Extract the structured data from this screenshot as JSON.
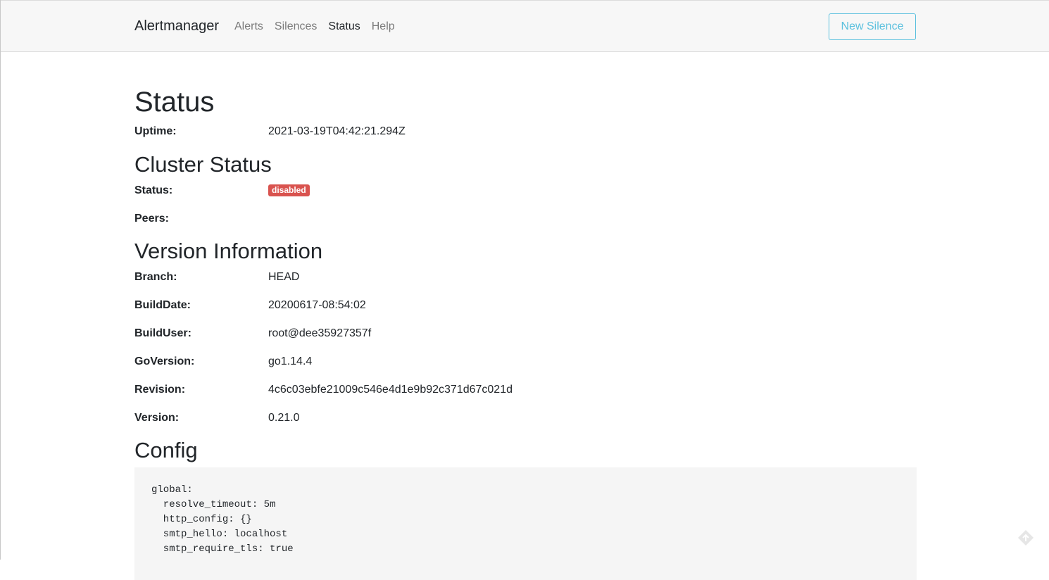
{
  "nav": {
    "brand": "Alertmanager",
    "links": [
      {
        "label": "Alerts"
      },
      {
        "label": "Silences"
      },
      {
        "label": "Status"
      },
      {
        "label": "Help"
      }
    ],
    "new_silence": "New Silence"
  },
  "status": {
    "title": "Status",
    "uptime_label": "Uptime:",
    "uptime_value": "2021-03-19T04:42:21.294Z"
  },
  "cluster": {
    "title": "Cluster Status",
    "status_label": "Status:",
    "status_badge": "disabled",
    "peers_label": "Peers:"
  },
  "version": {
    "title": "Version Information",
    "rows": [
      {
        "label": "Branch:",
        "value": "HEAD"
      },
      {
        "label": "BuildDate:",
        "value": "20200617-08:54:02"
      },
      {
        "label": "BuildUser:",
        "value": "root@dee35927357f"
      },
      {
        "label": "GoVersion:",
        "value": "go1.14.4"
      },
      {
        "label": "Revision:",
        "value": "4c6c03ebfe21009c546e4d1e9b92c371d67c021d"
      },
      {
        "label": "Version:",
        "value": "0.21.0"
      }
    ]
  },
  "config": {
    "title": "Config",
    "text": "global:\n  resolve_timeout: 5m\n  http_config: {}\n  smtp_hello: localhost\n  smtp_require_tls: true"
  },
  "colors": {
    "badge_disabled": "#d9534f",
    "button_info": "#5bc0de"
  }
}
